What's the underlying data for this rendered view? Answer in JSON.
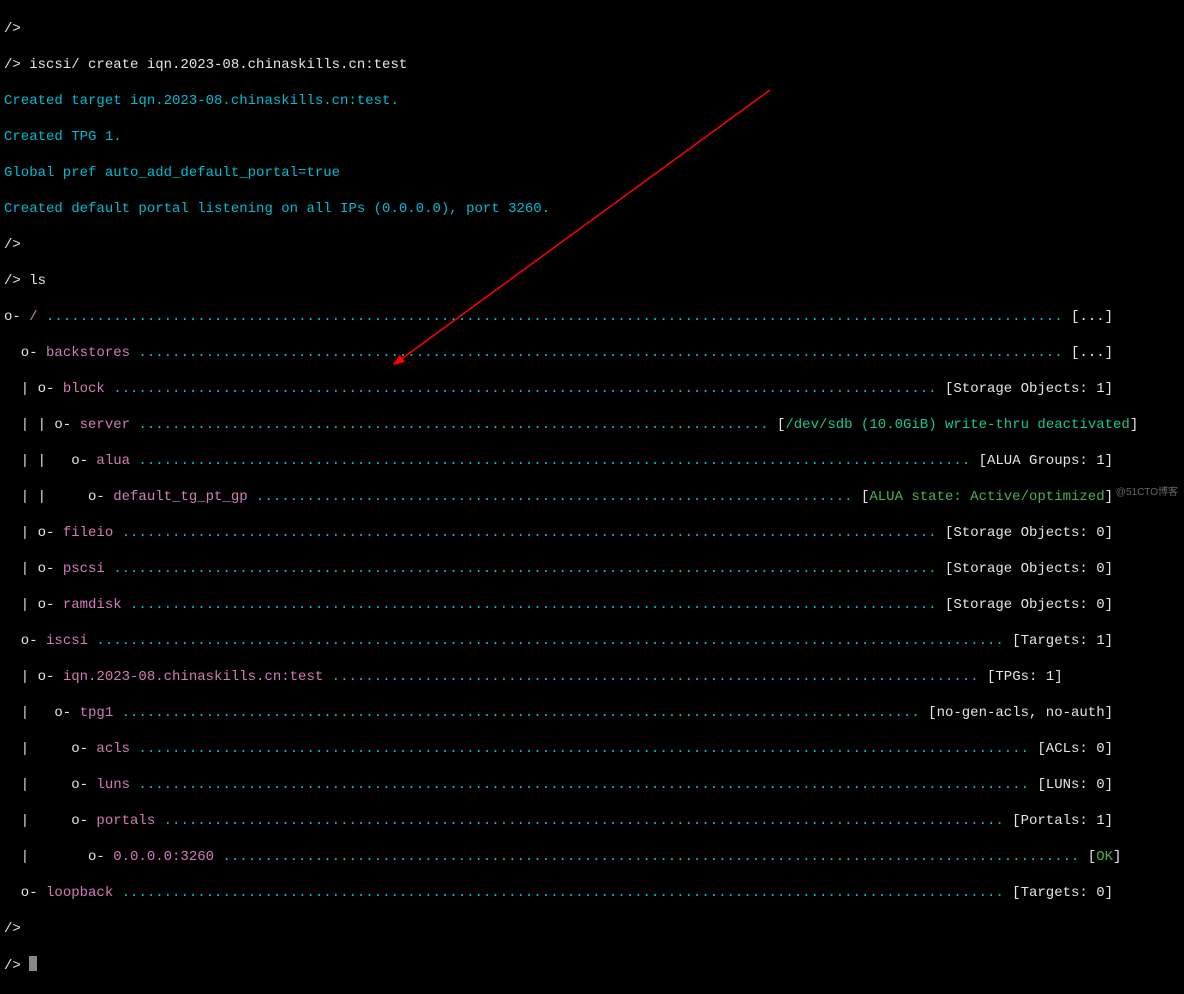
{
  "cmd1_prompt": "/>",
  "cmd1": "/> iscsi/ create iqn.2023-08.chinaskills.cn:test",
  "out1": "Created target iqn.2023-08.chinaskills.cn:test.",
  "out2": "Created TPG 1.",
  "out3": "Global pref auto_add_default_portal=true",
  "out4": "Created default portal listening on all IPs (0.0.0.0), port 3260.",
  "cmd2_prompt": "/>",
  "cmd2": "/> ls",
  "tree": {
    "root": {
      "prefix": "o- ",
      "name": "/",
      "dots": " .........................................................................................................................",
      "suffix": " [",
      "status": "...",
      "close": "]"
    },
    "backstores": {
      "prefix": "  o- ",
      "name": "backstores",
      "dots": " ..............................................................................................................",
      "suffix": " [",
      "status": "...",
      "close": "]"
    },
    "block": {
      "prefix": "  | o- ",
      "name": "block",
      "dots": " ..................................................................................................",
      "suffix": " [",
      "status": "Storage Objects: 1",
      "close": "]"
    },
    "server": {
      "prefix": "  | | o- ",
      "name": "server",
      "dots": " ...........................................................................",
      "suffix": " [",
      "status": "/dev/sdb (10.0GiB) write-thru deactivated",
      "close": "]"
    },
    "alua": {
      "prefix": "  | |   o- ",
      "name": "alua",
      "dots": " ...................................................................................................",
      "suffix": " [",
      "status": "ALUA Groups: 1",
      "close": "]"
    },
    "default_tg": {
      "prefix": "  | |     o- ",
      "name": "default_tg_pt_gp",
      "dots": " .......................................................................",
      "suffix": " [",
      "status": "ALUA state: Active/optimized",
      "close": "]"
    },
    "fileio": {
      "prefix": "  | o- ",
      "name": "fileio",
      "dots": " .................................................................................................",
      "suffix": " [",
      "status": "Storage Objects: 0",
      "close": "]"
    },
    "pscsi": {
      "prefix": "  | o- ",
      "name": "pscsi",
      "dots": " ..................................................................................................",
      "suffix": " [",
      "status": "Storage Objects: 0",
      "close": "]"
    },
    "ramdisk": {
      "prefix": "  | o- ",
      "name": "ramdisk",
      "dots": " ................................................................................................",
      "suffix": " [",
      "status": "Storage Objects: 0",
      "close": "]"
    },
    "iscsi": {
      "prefix": "  o- ",
      "name": "iscsi",
      "dots": " ............................................................................................................",
      "suffix": " [",
      "status": "Targets: 1",
      "close": "]"
    },
    "iqn": {
      "prefix": "  | o- ",
      "name": "iqn.2023-08.chinaskills.cn:test",
      "dots": " .............................................................................",
      "suffix": " [",
      "status": "TPGs: 1",
      "close": "]"
    },
    "tpg1": {
      "prefix": "  |   o- ",
      "name": "tpg1",
      "dots": " ...............................................................................................",
      "suffix": " [",
      "status": "no-gen-acls, no-auth",
      "close": "]"
    },
    "acls": {
      "prefix": "  |     o- ",
      "name": "acls",
      "dots": " ..........................................................................................................",
      "suffix": " [",
      "status": "ACLs: 0",
      "close": "]"
    },
    "luns": {
      "prefix": "  |     o- ",
      "name": "luns",
      "dots": " ..........................................................................................................",
      "suffix": " [",
      "status": "LUNs: 0",
      "close": "]"
    },
    "portals": {
      "prefix": "  |     o- ",
      "name": "portals",
      "dots": " ....................................................................................................",
      "suffix": " [",
      "status": "Portals: 1",
      "close": "]"
    },
    "portal0": {
      "prefix": "  |       o- ",
      "name": "0.0.0.0:3260",
      "dots": " ......................................................................................................",
      "suffix": " [",
      "status": "OK",
      "close": "]"
    },
    "loopback": {
      "prefix": "  o- ",
      "name": "loopback",
      "dots": " .........................................................................................................",
      "suffix": " [",
      "status": "Targets: 0",
      "close": "]"
    }
  },
  "prompt_final": "/> ",
  "watermark": "@51CTO博客"
}
